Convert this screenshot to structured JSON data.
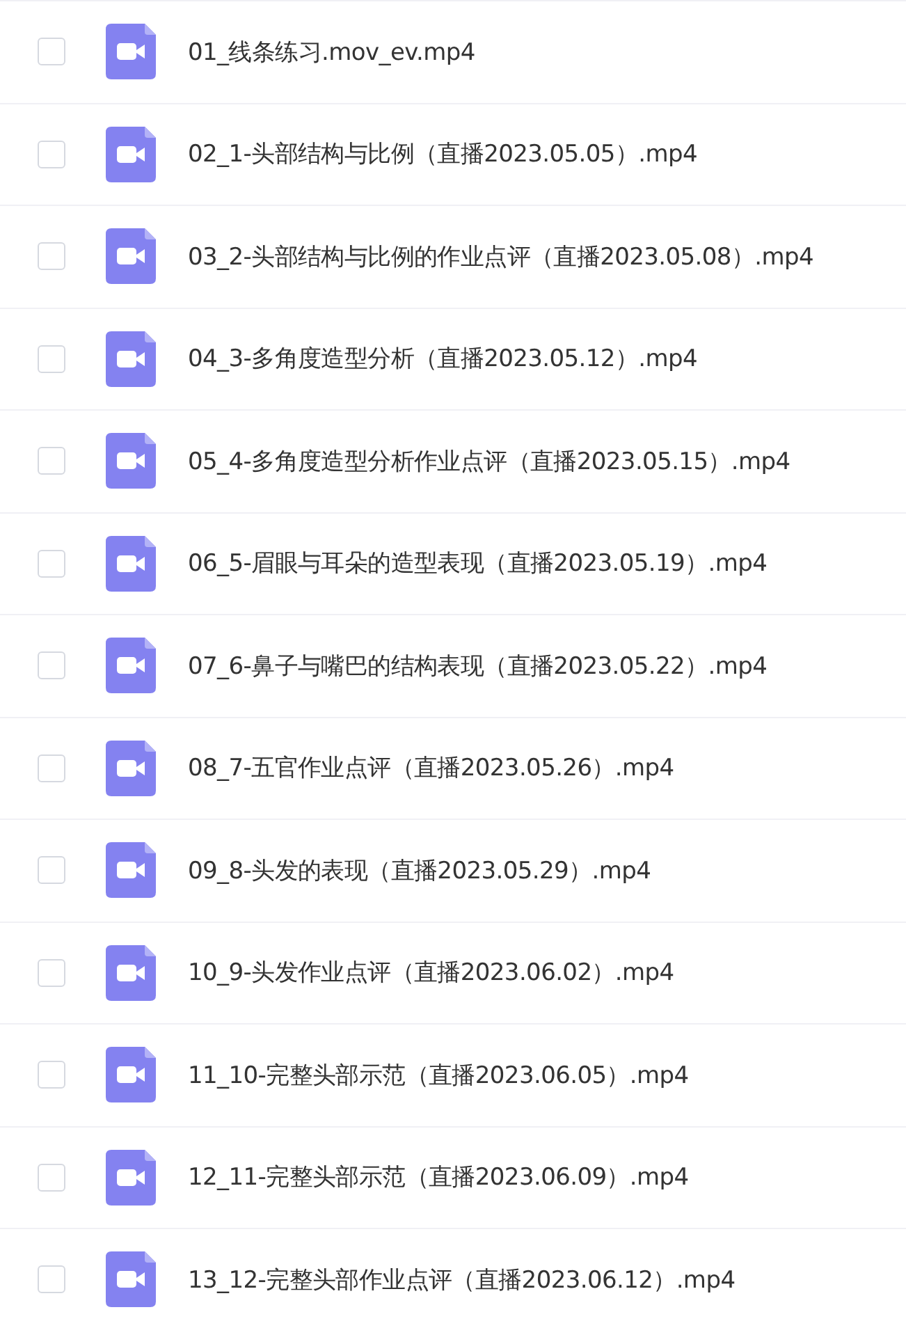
{
  "files": [
    {
      "name": "01_线条练习.mov_ev.mp4",
      "checked": false
    },
    {
      "name": "02_1-头部结构与比例（直播2023.05.05）.mp4",
      "checked": false
    },
    {
      "name": "03_2-头部结构与比例的作业点评（直播2023.05.08）.mp4",
      "checked": false
    },
    {
      "name": "04_3-多角度造型分析（直播2023.05.12）.mp4",
      "checked": false
    },
    {
      "name": "05_4-多角度造型分析作业点评（直播2023.05.15）.mp4",
      "checked": false
    },
    {
      "name": "06_5-眉眼与耳朵的造型表现（直播2023.05.19）.mp4",
      "checked": false
    },
    {
      "name": "07_6-鼻子与嘴巴的结构表现（直播2023.05.22）.mp4",
      "checked": false
    },
    {
      "name": "08_7-五官作业点评（直播2023.05.26）.mp4",
      "checked": false
    },
    {
      "name": "09_8-头发的表现（直播2023.05.29）.mp4",
      "checked": false
    },
    {
      "name": "10_9-头发作业点评（直播2023.06.02）.mp4",
      "checked": false
    },
    {
      "name": "11_10-完整头部示范（直播2023.06.05）.mp4",
      "checked": false
    },
    {
      "name": "12_11-完整头部示范（直播2023.06.09）.mp4",
      "checked": false
    },
    {
      "name": "13_12-完整头部作业点评（直播2023.06.12）.mp4",
      "checked": false
    }
  ]
}
